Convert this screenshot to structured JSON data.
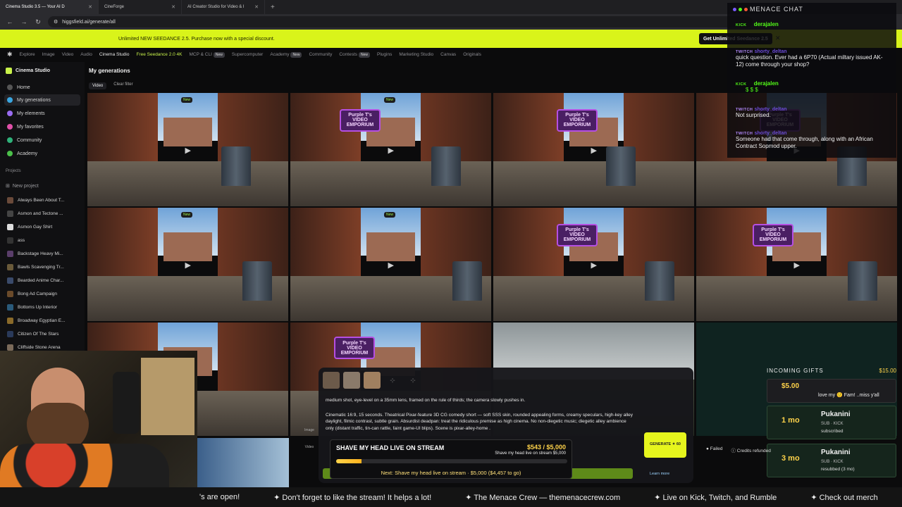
{
  "browser": {
    "tabs": [
      {
        "label": "Cinema Studio 3.5 — Your AI D",
        "active": true
      },
      {
        "label": "CineForge",
        "active": false
      },
      {
        "label": "AI Creator Studio for Video & I",
        "active": false
      }
    ],
    "url": "higgsfield.ai/generate/all"
  },
  "promo": {
    "text": "Unlimited NEW SEEDANCE 2.5. Purchase now with a special discount.",
    "cta": "Get Unlimited Seedance 2.5"
  },
  "topnav": {
    "items": [
      "Explore",
      "Image",
      "Video",
      "Audio",
      "Cinema Studio",
      "Free Seedance 2.0 4K",
      "MCP & CLI",
      "Supercomputer",
      "Academy",
      "Community",
      "Contests",
      "Plugins",
      "Marketing Studio",
      "Canvas",
      "Originals"
    ],
    "new_badge": "New"
  },
  "sidebar": {
    "title": "Cinema Studio",
    "items": [
      "Home",
      "My generations",
      "My elements",
      "My favorites",
      "Community",
      "Academy"
    ],
    "projects_label": "Projects",
    "new_project": "New project",
    "projects": [
      "Always Been About T...",
      "Asmon and Tectone ...",
      "Asmon Gay Shirt",
      "ass",
      "Backstage Heavy Mi...",
      "Bawls Scavenging Tr...",
      "Bearded Anime Char...",
      "Bong Ad Campaign",
      "Bottoms Up Interior",
      "Broadway Egyptian E...",
      "Citizen Of The Stars",
      "Cliffside Stone Arena"
    ]
  },
  "main": {
    "title": "My generations",
    "filter_chip": "Video",
    "clear_filter": "Clear filter",
    "sign_text": "Purple T's VIDEO EMPORIUM",
    "new_badge": "New"
  },
  "chat": {
    "title": "MENACE CHAT",
    "messages": [
      {
        "platform": "KICK",
        "user": "derajalen",
        "text": ""
      },
      {
        "platform": "TWITCH",
        "user": "shorty_deltan",
        "text": "quick question. Ever had a 6P70 (Actual miltary issued AK-12) come through your shop?"
      },
      {
        "platform": "KICK",
        "user": "derajalen",
        "text": "$ $ $"
      },
      {
        "platform": "TWITCH",
        "user": "shorty_deltan",
        "text": "Not surprised."
      },
      {
        "platform": "TWITCH",
        "user": "shorty_deltan",
        "text": "Someone had that come through, along with an African Contract Sopmod upper."
      }
    ],
    "colors": {
      "kick": "#53fc18",
      "twitch": "#b48bff"
    }
  },
  "gifts": {
    "title": "INCOMING GIFTS",
    "total": "$15.00",
    "partial": {
      "amount": "$5.00",
      "text": "love my 🙂 Fam! ..miss y'all"
    },
    "cards": [
      {
        "months": "1 mo",
        "name": "Pukanini",
        "type": "SUB · KICK",
        "status": "subscribed"
      },
      {
        "months": "3 mo",
        "name": "Pukanini",
        "type": "SUB · KICK",
        "status": "resubbed (3 mo)"
      }
    ]
  },
  "prompt": {
    "line1": "medium shot, eye-level on a 35mm lens, framed on the rule of thirds; the camera slowly pushes in.",
    "line2": "Cinematic 16:9, 15 seconds. Theatrical Pixar-feature 3D CG comedy short — soft SSS skin, rounded appealing forms, creamy speculars, high-key alley daylight, filmic contrast, subtle grain. Absurdist deadpan: treat the ridiculous premise as high cinema. No non-diegetic music; diegetic alley ambience only (distant traffic, tin-can rattle, faint game-UI blips). Scene is pixar-alley-home .",
    "side_image": "Image",
    "side_video": "Video",
    "generate": "GENERATE ✦ 60",
    "learn_more": "Learn more"
  },
  "goal": {
    "title": "SHAVE MY HEAD LIVE ON STREAM",
    "amount": "$543 / $5,000",
    "subtitle": "Shave my head live on stream $5,000",
    "progress": 0.1086,
    "next": "Next: Shave my head live on stream · $5,000 ($4,457 to go)"
  },
  "status": {
    "failed": "Failed",
    "refunded": "Credits refunded"
  },
  "ticker": [
    "'s are open!",
    "Don't forget to like the stream! It helps a lot!",
    "The Menace Crew — themenacecrew.com",
    "Live on Kick, Twitch, and Rumble",
    "Check out merch"
  ]
}
